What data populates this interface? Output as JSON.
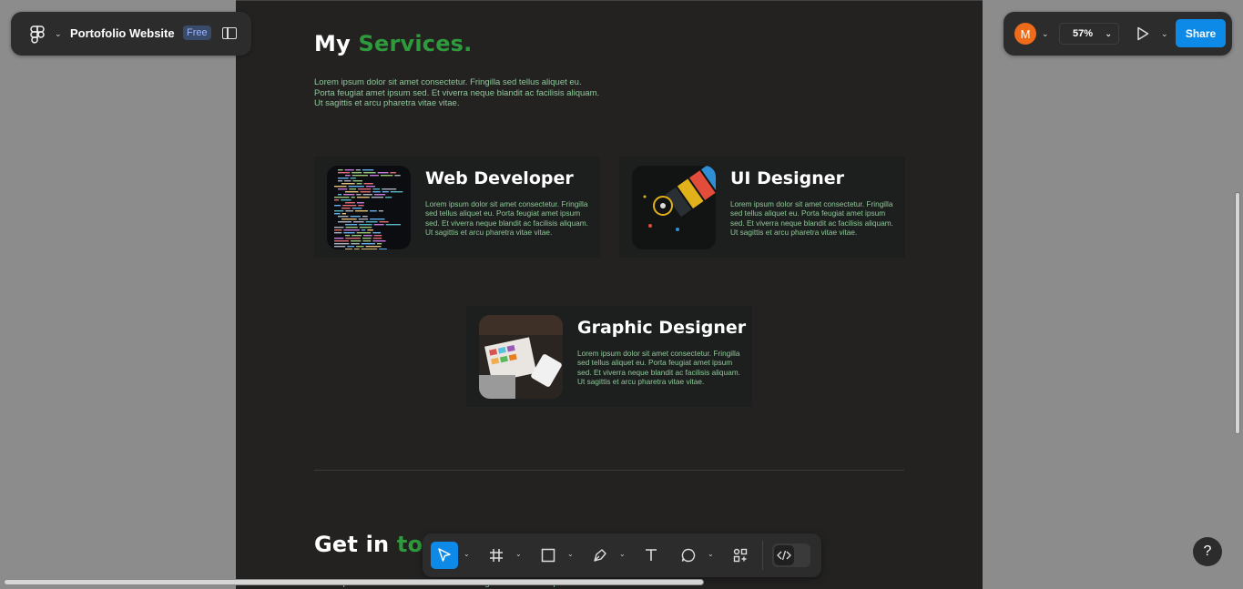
{
  "app": {
    "file_name": "Portofolio Website",
    "plan_badge": "Free",
    "user_initial": "M",
    "zoom_level": "57%",
    "share_label": "Share",
    "help_label": "?"
  },
  "services": {
    "heading_part1": "My",
    "heading_part2": "Services.",
    "intro": "Lorem ipsum dolor sit amet consectetur. Fringilla sed tellus aliquet eu. Porta feugiat amet ipsum sed. Et viverra neque blandit ac facilisis aliquam. Ut sagittis et arcu pharetra vitae vitae.",
    "cards": [
      {
        "title": "Web Developer",
        "description": "Lorem ipsum dolor sit amet consectetur. Fringilla sed tellus aliquet eu. Porta feugiat amet ipsum sed. Et viverra neque blandit ac facilisis aliquam. Ut sagittis et arcu pharetra vitae vitae."
      },
      {
        "title": "UI Designer",
        "description": "Lorem ipsum dolor sit amet consectetur. Fringilla sed tellus aliquet eu. Porta feugiat amet ipsum sed. Et viverra neque blandit ac facilisis aliquam. Ut sagittis et arcu pharetra vitae vitae."
      },
      {
        "title": "Graphic Designer",
        "description": "Lorem ipsum dolor sit amet consectetur. Fringilla sed tellus aliquet eu. Porta feugiat amet ipsum sed. Et viverra neque blandit ac facilisis aliquam. Ut sagittis et arcu pharetra vitae vitae."
      }
    ]
  },
  "contact": {
    "heading_part1": "Get in",
    "heading_part2": "tou",
    "description": "Lorem ipsum dolor sit amet consectetur. Fringilla sed tellus aliquet"
  },
  "toolbar": {
    "tools": [
      "move-tool",
      "frame-tool",
      "shape-tool",
      "pen-tool",
      "text-tool",
      "comment-tool",
      "actions-tool",
      "dev-mode-toggle"
    ]
  },
  "colors": {
    "accent_green": "#2e9a3c",
    "primary_blue": "#0d8ae8",
    "avatar_orange": "#ee6b1a"
  }
}
